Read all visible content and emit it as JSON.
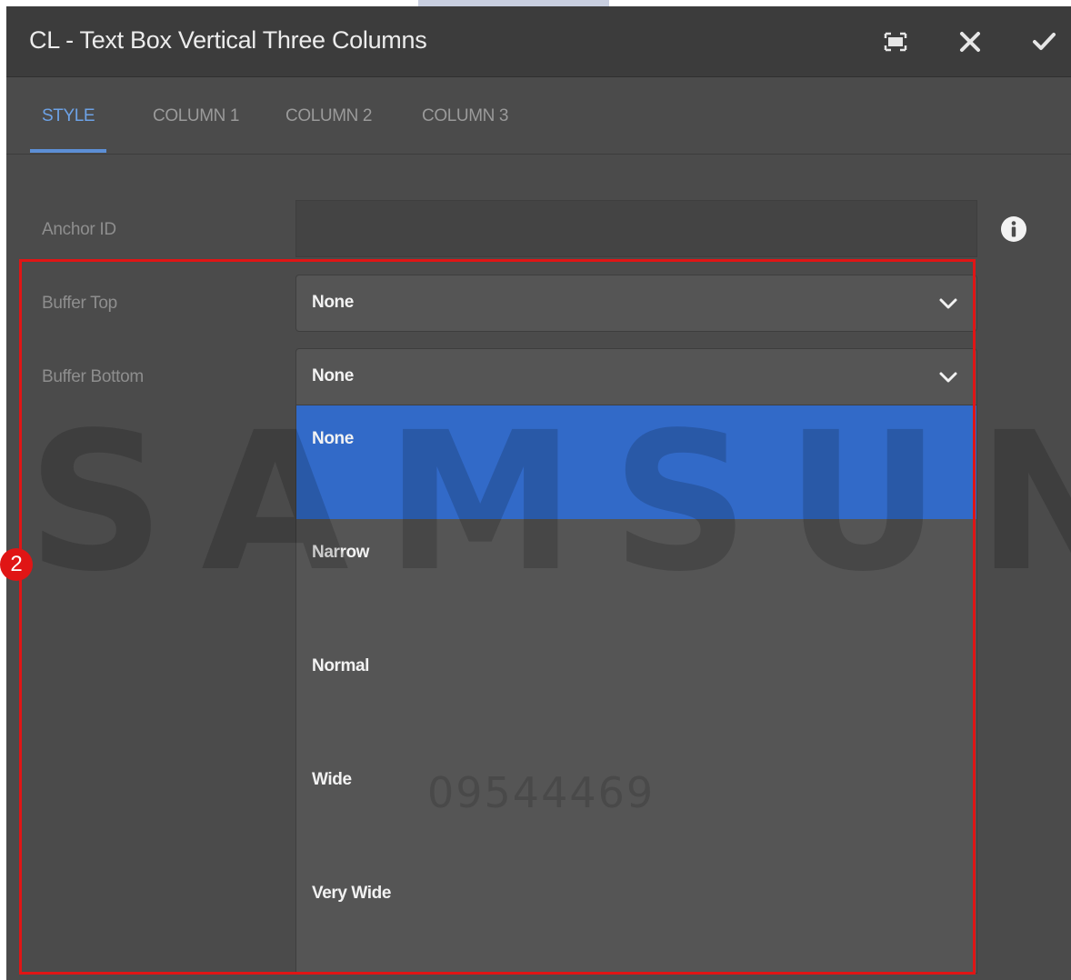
{
  "dialog": {
    "title": "CL - Text Box Vertical Three Columns",
    "buttons": {
      "fullscreen": "fullscreen-icon",
      "close": "close-icon",
      "done": "check-icon"
    }
  },
  "tabs": [
    {
      "label": "STYLE",
      "active": true
    },
    {
      "label": "COLUMN 1",
      "active": false
    },
    {
      "label": "COLUMN 2",
      "active": false
    },
    {
      "label": "COLUMN 3",
      "active": false
    }
  ],
  "form": {
    "anchor_id": {
      "label": "Anchor ID",
      "value": ""
    },
    "buffer_top": {
      "label": "Buffer Top",
      "value": "None"
    },
    "buffer_bottom": {
      "label": "Buffer Bottom",
      "value": "None",
      "options": [
        "None",
        "Narrow",
        "Normal",
        "Wide",
        "Very Wide"
      ],
      "highlighted_option": "None"
    }
  },
  "annotation": {
    "badge": "2"
  },
  "watermark": {
    "brand": "SAMSUNG",
    "code": "09544469"
  },
  "colors": {
    "accent": "#6da2e6",
    "selection": "#326ac8",
    "annotation": "#e01515",
    "panel": "#4b4b4b"
  }
}
